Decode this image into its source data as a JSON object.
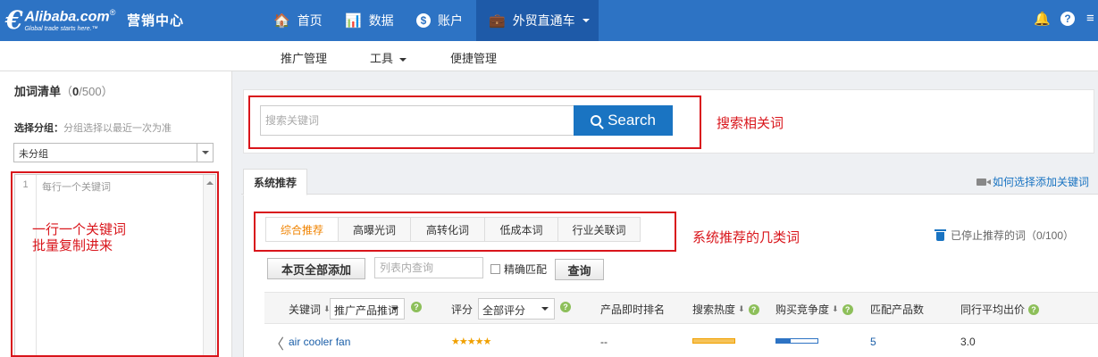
{
  "header": {
    "logo_mark": "€",
    "logo_brand": "Alibaba.com",
    "logo_reg": "®",
    "logo_tagline": "Global trade starts here.™",
    "center_title": "营销中心",
    "nav": [
      {
        "label": "首页",
        "icon": "home-icon",
        "glyph": "🏠"
      },
      {
        "label": "数据",
        "icon": "bar-chart-icon",
        "glyph": "📊"
      },
      {
        "label": "账户",
        "icon": "dollar-icon",
        "glyph": "$"
      },
      {
        "label": "外贸直通车",
        "icon": "briefcase-icon",
        "glyph": "💼"
      }
    ],
    "bell_glyph": "🔔",
    "help_glyph": "?",
    "more_glyph": "≡"
  },
  "subnav": {
    "items": [
      "推广管理",
      "工具",
      "便捷管理"
    ]
  },
  "left_panel": {
    "title": "加词清单",
    "count_open": "（",
    "count_value": "0",
    "count_total": "/500",
    "count_close": "）",
    "group_label": "选择分组：",
    "group_hint": "分组选择以最近一次为准",
    "group_value": "未分组",
    "line_number": "1",
    "keyword_placeholder": "每行一个关键词"
  },
  "annotations": {
    "left_note_line1": "一行一个关键词",
    "left_note_line2": "批量复制进来",
    "search_note": "搜索相关词",
    "tabs_note": "系统推荐的几类词"
  },
  "search": {
    "placeholder": "搜索关键词",
    "button_label": "Search"
  },
  "main": {
    "tab_label": "系统推荐",
    "howto_link": "如何选择添加关键词",
    "subtabs": [
      "综合推荐",
      "高曝光词",
      "高转化词",
      "低成本词",
      "行业关联词"
    ],
    "stopped_label": "已停止推荐的词（0/100）",
    "add_all_button": "本页全部添加",
    "filter_placeholder": "列表内查询",
    "exact_match_label": "精确匹配",
    "query_button": "查询"
  },
  "table": {
    "col_keyword": "关键词",
    "col_keyword_select": "推广产品推词",
    "col_score": "评分",
    "col_score_select": "全部评分",
    "col_rank": "产品即时排名",
    "col_heat": "搜索热度",
    "col_competition": "购买竞争度",
    "col_match": "匹配产品数",
    "col_avg_bid": "同行平均出价",
    "sort_glyph": "⬇",
    "help_glyph": "?",
    "prev_glyph": "〈",
    "rows": [
      {
        "keyword": "air cooler fan",
        "stars": "★★★★★",
        "rating": 5,
        "rank": "--",
        "heat_level": 1.0,
        "competition_level": 0.35,
        "match_count": "5",
        "avg_bid": "3.0"
      }
    ]
  },
  "colors": {
    "topbar": "#2d73c4",
    "accent_blue": "#1a74c2",
    "annotation_red": "#d9151b",
    "active_tab_orange": "#f08300",
    "heat_bar": "#f0a000",
    "competition_bar": "#2d73c4"
  }
}
